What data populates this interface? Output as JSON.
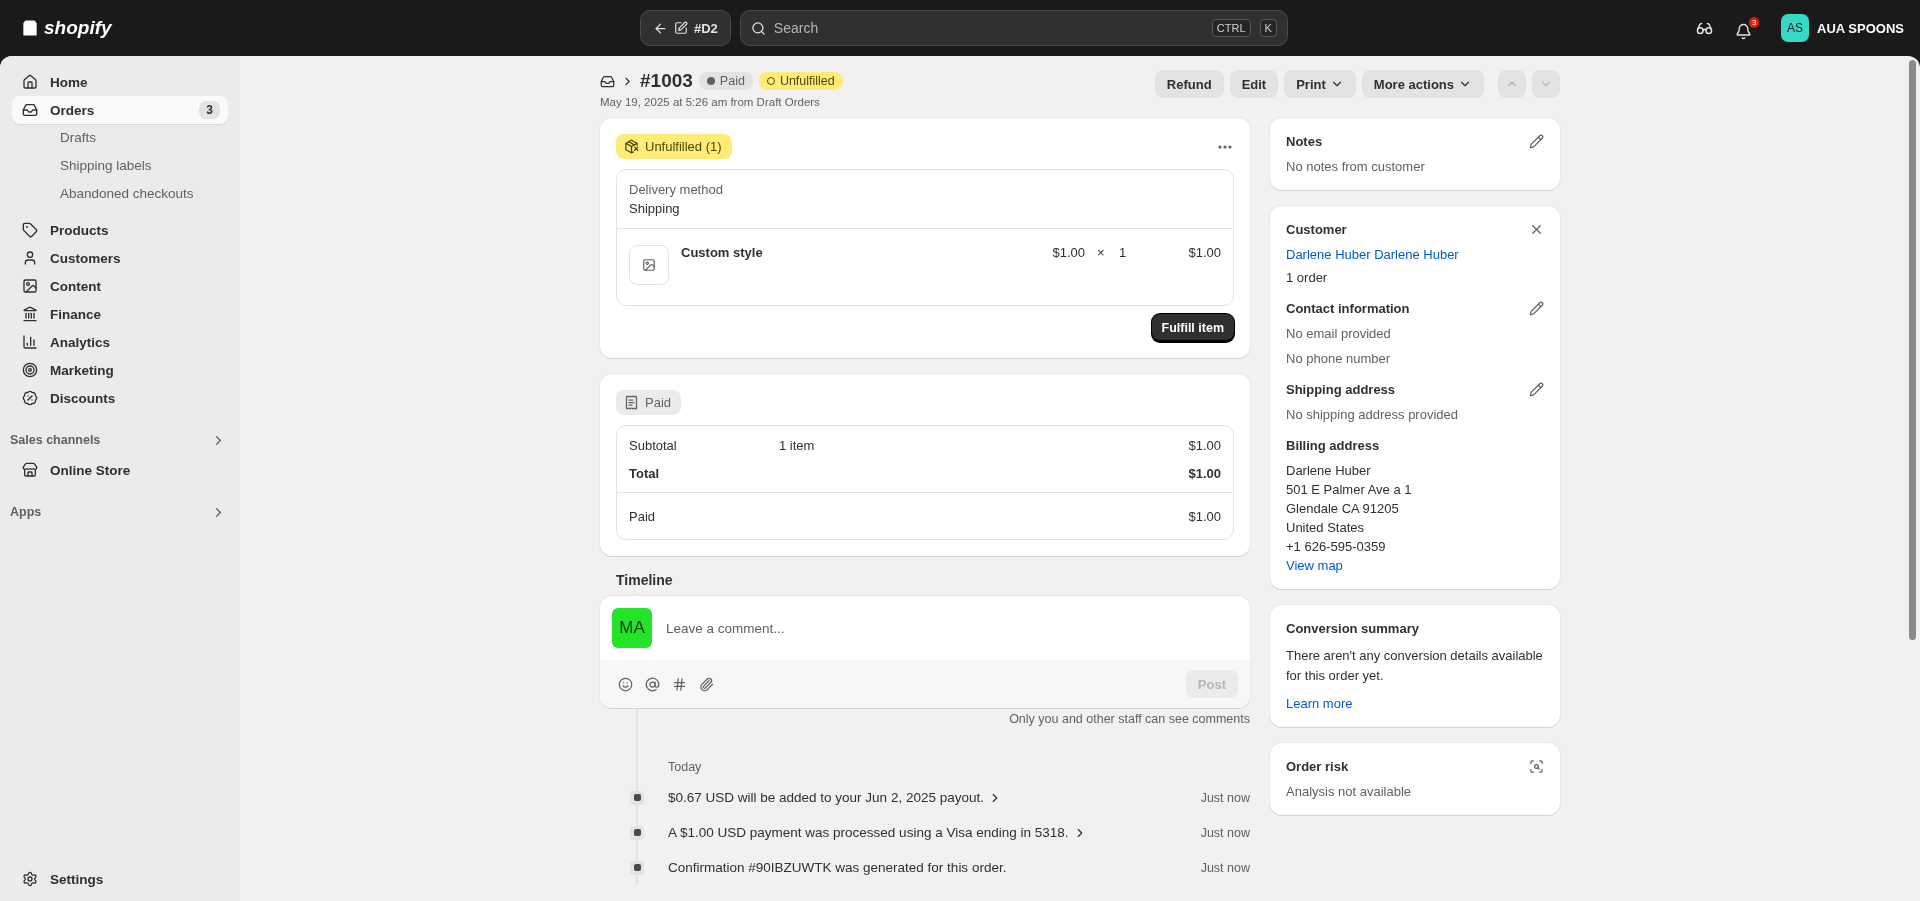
{
  "topbar": {
    "logo": "shopify",
    "back_chip": "#D2",
    "search": {
      "placeholder": "Search"
    },
    "shortcut_keys": [
      "CTRL",
      "K"
    ],
    "notification_count": "3",
    "store": {
      "initials": "AS",
      "name": "AUA SPOONS"
    }
  },
  "sidebar": {
    "items": [
      {
        "label": "Home",
        "selected": false
      },
      {
        "label": "Orders",
        "selected": true,
        "badge": "3",
        "children": [
          {
            "label": "Drafts"
          },
          {
            "label": "Shipping labels"
          },
          {
            "label": "Abandoned checkouts"
          }
        ]
      },
      {
        "label": "Products",
        "selected": false
      },
      {
        "label": "Customers",
        "selected": false
      },
      {
        "label": "Content",
        "selected": false
      },
      {
        "label": "Finance",
        "selected": false
      },
      {
        "label": "Analytics",
        "selected": false
      },
      {
        "label": "Marketing",
        "selected": false
      },
      {
        "label": "Discounts",
        "selected": false
      }
    ],
    "sections": [
      {
        "label": "Sales channels",
        "items": [
          {
            "label": "Online Store",
            "selected": false
          }
        ]
      },
      {
        "label": "Apps"
      }
    ],
    "settings": "Settings"
  },
  "header": {
    "title": "#1003",
    "badges": [
      {
        "label": "Paid",
        "kind": "neutral"
      },
      {
        "label": "Unfulfilled",
        "kind": "warning"
      }
    ],
    "subtitle": "May 19, 2025 at 5:26 am from Draft Orders",
    "actions": [
      {
        "label": "Refund",
        "menu": false
      },
      {
        "label": "Edit",
        "menu": false
      },
      {
        "label": "Print",
        "menu": true
      },
      {
        "label": "More actions",
        "menu": true
      }
    ],
    "nav": {
      "previous_disabled": true,
      "next_disabled": true
    }
  },
  "fulfillment": {
    "badge": "Unfulfilled (1)",
    "delivery_label": "Delivery method",
    "delivery_value": "Shipping",
    "line_items": [
      {
        "name": "Custom style",
        "price": "$1.00",
        "times": "×",
        "quantity": "1",
        "total": "$1.00"
      }
    ],
    "button": "Fulfill item"
  },
  "payment": {
    "badge": "Paid",
    "rows": [
      {
        "label": "Subtotal",
        "detail": "1 item",
        "amount": "$1.00",
        "bold": false
      },
      {
        "label": "Total",
        "amount": "$1.00",
        "bold": true
      }
    ],
    "paid_row": {
      "label": "Paid",
      "amount": "$1.00"
    }
  },
  "timeline": {
    "title": "Timeline",
    "comment": {
      "avatar": "MA",
      "placeholder": "Leave a comment...",
      "post": {
        "label": "Post",
        "disabled": true
      }
    },
    "note": "Only you and other staff can see comments",
    "date_heading": "Today",
    "events": [
      {
        "text": "$0.67 USD will be added to your Jun 2, 2025 payout.",
        "time": "Just now",
        "expandable": true
      },
      {
        "text": "A $1.00 USD payment was processed using a Visa ending in 5318.",
        "time": "Just now",
        "expandable": true
      },
      {
        "text": "Confirmation #90IBZUWTK was generated for this order.",
        "time": "Just now",
        "expandable": false
      }
    ]
  },
  "notes": {
    "title": "Notes",
    "text": "No notes from customer"
  },
  "customer": {
    "title": "Customer",
    "name": "Darlene Huber Darlene Huber",
    "orders": "1 order",
    "contact": {
      "title": "Contact information",
      "lines": [
        "No email provided",
        "No phone number"
      ]
    },
    "shipping": {
      "title": "Shipping address",
      "lines": [
        "No shipping address provided"
      ]
    },
    "billing": {
      "title": "Billing address",
      "lines": [
        "Darlene Huber",
        "501 E Palmer Ave a 1",
        "Glendale CA 91205",
        "United States",
        "+1 626-595-0359"
      ],
      "link": "View map"
    }
  },
  "conversion": {
    "title": "Conversion summary",
    "text": "There aren't any conversion details available for this order yet.",
    "link": "Learn more"
  },
  "risk": {
    "title": "Order risk",
    "text": "Analysis not available"
  }
}
